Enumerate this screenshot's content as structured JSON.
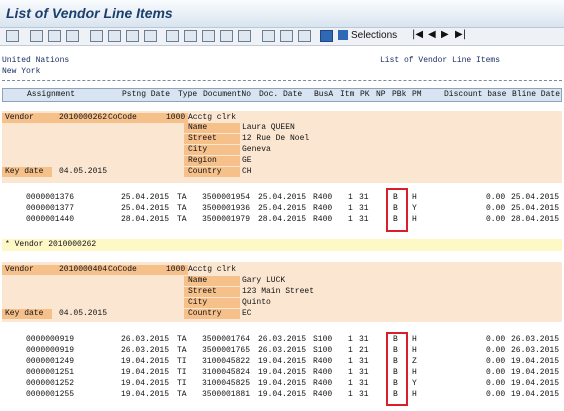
{
  "title": "List of Vendor Line Items",
  "toolbar": {
    "selections_label": "Selections",
    "nav_first": "|◀",
    "nav_prev": "◀",
    "nav_next": "▶",
    "nav_last": "▶|"
  },
  "report_header": {
    "company": "United Nations",
    "city": "New York",
    "report_title": "List of Vendor Line Items"
  },
  "columns": [
    "Assignment",
    "Pstng Date",
    "Type",
    "DocumentNo",
    "Doc. Date",
    "BusA",
    "Itm",
    "PK",
    "NP",
    "PBk",
    "PM",
    "Discount base",
    "Bline Date"
  ],
  "vendors": [
    {
      "vendor_label": "Vendor",
      "vendor_no": "2010000262",
      "cocode_label": "CoCode",
      "cocode": "1000",
      "accclerk_label": "Acctg clrk",
      "name_label": "Name",
      "name": "Laura QUEEN",
      "street_label": "Street",
      "street": "12 Rue De Noel",
      "city_label": "City",
      "city": "Geneva",
      "region_label": "Region",
      "region": "GE",
      "country_label": "Country",
      "country": "CH",
      "keydate_label": "Key date",
      "keydate": "04.05.2015",
      "items": [
        {
          "assignment": "0000001376",
          "pstng": "25.04.2015",
          "type": "TA",
          "docno": "3500001954",
          "docdate": "25.04.2015",
          "busa": "R400",
          "itm": "1",
          "pk": "31",
          "np": "",
          "pbk": "B",
          "pm": "H",
          "disc": "0.00",
          "bline": "25.04.2015"
        },
        {
          "assignment": "0000001377",
          "pstng": "25.04.2015",
          "type": "TA",
          "docno": "3500001936",
          "docdate": "25.04.2015",
          "busa": "R400",
          "itm": "1",
          "pk": "31",
          "np": "",
          "pbk": "B",
          "pm": "Y",
          "disc": "0.00",
          "bline": "25.04.2015"
        },
        {
          "assignment": "0000001440",
          "pstng": "28.04.2015",
          "type": "TA",
          "docno": "3500001979",
          "docdate": "28.04.2015",
          "busa": "R400",
          "itm": "1",
          "pk": "31",
          "np": "",
          "pbk": "B",
          "pm": "H",
          "disc": "0.00",
          "bline": "28.04.2015"
        }
      ],
      "total_label": "*  Vendor 2010000262"
    },
    {
      "vendor_label": "Vendor",
      "vendor_no": "2010000404",
      "cocode_label": "CoCode",
      "cocode": "1000",
      "accclerk_label": "Acctg clrk",
      "name_label": "Name",
      "name": "Gary LUCK",
      "street_label": "Street",
      "street": "123 Main Street",
      "city_label": "City",
      "city": "Quinto",
      "country_label": "Country",
      "country": "EC",
      "keydate_label": "Key date",
      "keydate": "04.05.2015",
      "items": [
        {
          "assignment": "0000000919",
          "pstng": "26.03.2015",
          "type": "TA",
          "docno": "3500001764",
          "docdate": "26.03.2015",
          "busa": "S100",
          "itm": "1",
          "pk": "31",
          "np": "",
          "pbk": "B",
          "pm": "H",
          "disc": "0.00",
          "bline": "26.03.2015"
        },
        {
          "assignment": "0000000919",
          "pstng": "26.03.2015",
          "type": "TA",
          "docno": "3500001765",
          "docdate": "26.03.2015",
          "busa": "S100",
          "itm": "1",
          "pk": "21",
          "np": "",
          "pbk": "B",
          "pm": "H",
          "disc": "0.00",
          "bline": "26.03.2015"
        },
        {
          "assignment": "0000001249",
          "pstng": "19.04.2015",
          "type": "TI",
          "docno": "3100045822",
          "docdate": "19.04.2015",
          "busa": "R400",
          "itm": "1",
          "pk": "31",
          "np": "",
          "pbk": "B",
          "pm": "Z",
          "disc": "0.00",
          "bline": "19.04.2015"
        },
        {
          "assignment": "0000001251",
          "pstng": "19.04.2015",
          "type": "TI",
          "docno": "3100045824",
          "docdate": "19.04.2015",
          "busa": "R400",
          "itm": "1",
          "pk": "31",
          "np": "",
          "pbk": "B",
          "pm": "H",
          "disc": "0.00",
          "bline": "19.04.2015"
        },
        {
          "assignment": "0000001252",
          "pstng": "19.04.2015",
          "type": "TI",
          "docno": "3100045825",
          "docdate": "19.04.2015",
          "busa": "R400",
          "itm": "1",
          "pk": "31",
          "np": "",
          "pbk": "B",
          "pm": "Y",
          "disc": "0.00",
          "bline": "19.04.2015"
        },
        {
          "assignment": "0000001255",
          "pstng": "19.04.2015",
          "type": "TA",
          "docno": "3500001881",
          "docdate": "19.04.2015",
          "busa": "R400",
          "itm": "1",
          "pk": "31",
          "np": "",
          "pbk": "B",
          "pm": "H",
          "disc": "0.00",
          "bline": "19.04.2015"
        }
      ]
    }
  ]
}
